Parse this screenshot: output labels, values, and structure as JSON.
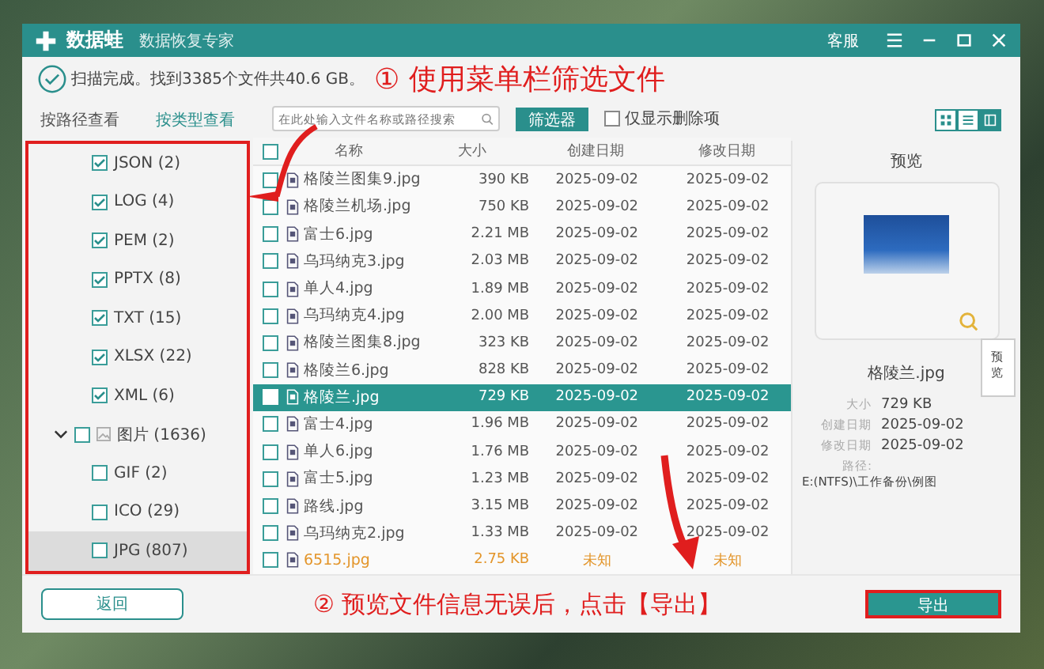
{
  "app": {
    "name": "数据蛙",
    "subtitle": "数据恢复专家",
    "support": "客服"
  },
  "status": {
    "message": "扫描完成。找到3385个文件共40.6 GB。"
  },
  "annotations": [
    {
      "text": "① 使用菜单栏筛选文件"
    },
    {
      "text": "② 预览文件信息无误后，点击【导出】"
    }
  ],
  "view_tabs": [
    {
      "label": "按路径查看",
      "selected": false
    },
    {
      "label": "按类型查看",
      "selected": true
    }
  ],
  "type_tree": [
    {
      "label": "JSON (2)",
      "checked": true,
      "selected": false
    },
    {
      "label": "LOG (4)",
      "checked": true,
      "selected": false
    },
    {
      "label": "PEM (2)",
      "checked": true,
      "selected": false
    },
    {
      "label": "PPTX (8)",
      "checked": true,
      "selected": false
    },
    {
      "label": "TXT (15)",
      "checked": true,
      "selected": false
    },
    {
      "label": "XLSX (22)",
      "checked": true,
      "selected": false
    },
    {
      "label": "XML (6)",
      "checked": true,
      "selected": false
    },
    {
      "label": "图片 (1636)",
      "checked": false,
      "selected": false,
      "expanded": true,
      "children": [
        {
          "label": "GIF (2)",
          "checked": false,
          "selected": false
        },
        {
          "label": "ICO (29)",
          "checked": false,
          "selected": false
        },
        {
          "label": "JPG (807)",
          "checked": false,
          "selected": true
        }
      ]
    }
  ],
  "search": {
    "placeholder": "在此处输入文件名称或路径搜索"
  },
  "filter_button": "筛选器",
  "deleted_only": {
    "label": "仅显示删除项",
    "checked": false
  },
  "view_modes": [
    {
      "kind": "grid",
      "selected": false
    },
    {
      "kind": "list",
      "selected": false
    },
    {
      "kind": "detail",
      "selected": true
    }
  ],
  "table": {
    "select_all_checked": false,
    "columns": [
      "名称",
      "大小",
      "创建日期",
      "修改日期"
    ],
    "rows": [
      {
        "name": "格陵兰图集9.jpg",
        "size": "390 KB",
        "created": "2025-09-02",
        "modified": "2025-09-02",
        "checked": false,
        "selected": false,
        "unknown": false
      },
      {
        "name": "格陵兰机场.jpg",
        "size": "750 KB",
        "created": "2025-09-02",
        "modified": "2025-09-02",
        "checked": false,
        "selected": false,
        "unknown": false
      },
      {
        "name": "富士6.jpg",
        "size": "2.21 MB",
        "created": "2025-09-02",
        "modified": "2025-09-02",
        "checked": false,
        "selected": false,
        "unknown": false
      },
      {
        "name": "乌玛纳克3.jpg",
        "size": "2.03 MB",
        "created": "2025-09-02",
        "modified": "2025-09-02",
        "checked": false,
        "selected": false,
        "unknown": false
      },
      {
        "name": "单人4.jpg",
        "size": "1.89 MB",
        "created": "2025-09-02",
        "modified": "2025-09-02",
        "checked": false,
        "selected": false,
        "unknown": false
      },
      {
        "name": "乌玛纳克4.jpg",
        "size": "2.00 MB",
        "created": "2025-09-02",
        "modified": "2025-09-02",
        "checked": false,
        "selected": false,
        "unknown": false
      },
      {
        "name": "格陵兰图集8.jpg",
        "size": "323 KB",
        "created": "2025-09-02",
        "modified": "2025-09-02",
        "checked": false,
        "selected": false,
        "unknown": false
      },
      {
        "name": "格陵兰6.jpg",
        "size": "828 KB",
        "created": "2025-09-02",
        "modified": "2025-09-02",
        "checked": false,
        "selected": false,
        "unknown": false
      },
      {
        "name": "格陵兰.jpg",
        "size": "729 KB",
        "created": "2025-09-02",
        "modified": "2025-09-02",
        "checked": false,
        "selected": true,
        "unknown": false
      },
      {
        "name": "富士4.jpg",
        "size": "1.96 MB",
        "created": "2025-09-02",
        "modified": "2025-09-02",
        "checked": false,
        "selected": false,
        "unknown": false
      },
      {
        "name": "单人6.jpg",
        "size": "1.76 MB",
        "created": "2025-09-02",
        "modified": "2025-09-02",
        "checked": false,
        "selected": false,
        "unknown": false
      },
      {
        "name": "富士5.jpg",
        "size": "1.23 MB",
        "created": "2025-09-02",
        "modified": "2025-09-02",
        "checked": false,
        "selected": false,
        "unknown": false
      },
      {
        "name": "路线.jpg",
        "size": "3.15 MB",
        "created": "2025-09-02",
        "modified": "2025-09-02",
        "checked": false,
        "selected": false,
        "unknown": false
      },
      {
        "name": "乌玛纳克2.jpg",
        "size": "1.33 MB",
        "created": "2025-09-02",
        "modified": "2025-09-02",
        "checked": false,
        "selected": false,
        "unknown": false
      },
      {
        "name": "6515.jpg",
        "size": "2.75 KB",
        "created": "未知",
        "modified": "未知",
        "checked": false,
        "selected": false,
        "unknown": true
      }
    ]
  },
  "preview": {
    "title": "预览",
    "tooltip": "预览",
    "filename": "格陵兰.jpg",
    "properties": [
      {
        "label": "大小",
        "value": "729 KB",
        "kind": "inline"
      },
      {
        "label": "创建日期",
        "value": "2025-09-02",
        "kind": "inline"
      },
      {
        "label": "修改日期",
        "value": "2025-09-02",
        "kind": "inline"
      },
      {
        "label": "路径:",
        "value": "E:(NTFS)\\工作备份\\例图",
        "kind": "block"
      }
    ]
  },
  "buttons": {
    "back": "返回",
    "export": "导出"
  }
}
